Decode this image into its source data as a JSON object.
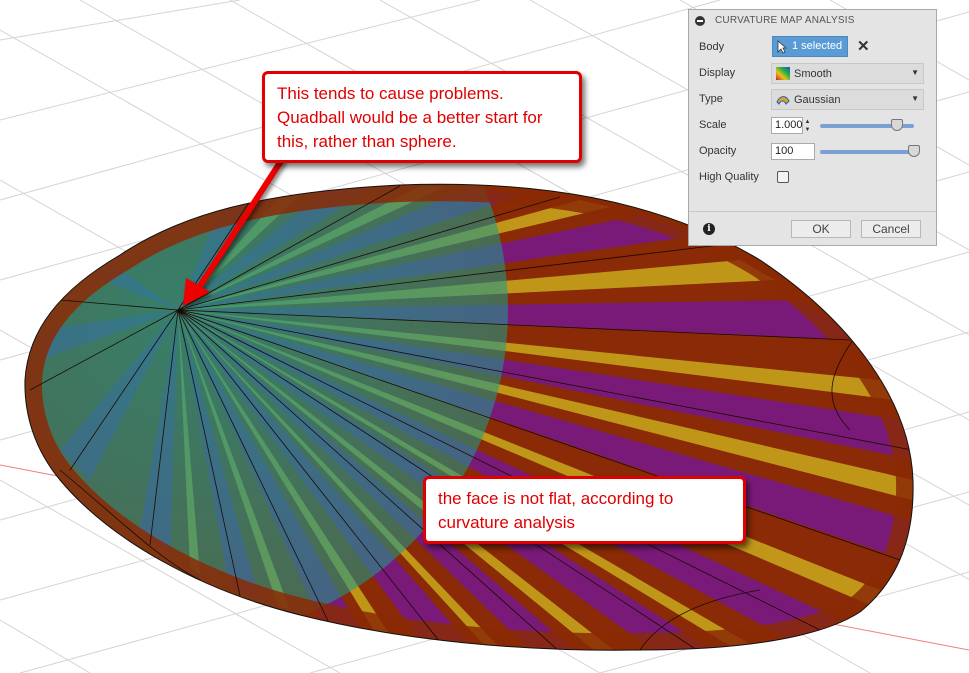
{
  "dialog": {
    "title": "CURVATURE MAP ANALYSIS",
    "body_label": "Body",
    "body_value": "1 selected",
    "display_label": "Display",
    "display_value": "Smooth",
    "type_label": "Type",
    "type_value": "Gaussian",
    "scale_label": "Scale",
    "scale_value": "1.000",
    "scale_slider_level": 0.84,
    "opacity_label": "Opacity",
    "opacity_value": "100",
    "opacity_slider_level": 1.0,
    "high_quality_label": "High Quality",
    "high_quality_checked": false,
    "ok_label": "OK",
    "cancel_label": "Cancel",
    "icons": [
      "collapse-icon",
      "cursor-icon",
      "close-icon",
      "rainbow-icon",
      "gaussian-icon",
      "chevron-down-icon",
      "info-icon"
    ]
  },
  "callouts": {
    "top_text": "This tends to cause problems. Quadball would be a better start for this, rather than sphere.",
    "bottom_text": "the face is not flat, according to curvature analysis"
  },
  "colors": {
    "accent": "#e00000",
    "selection_blue": "#5b9bd5",
    "surface_base": "#8a2a06",
    "surface_purple": "#7a1a78",
    "surface_green": "#1fa889",
    "surface_yellow": "#c6a21c"
  }
}
